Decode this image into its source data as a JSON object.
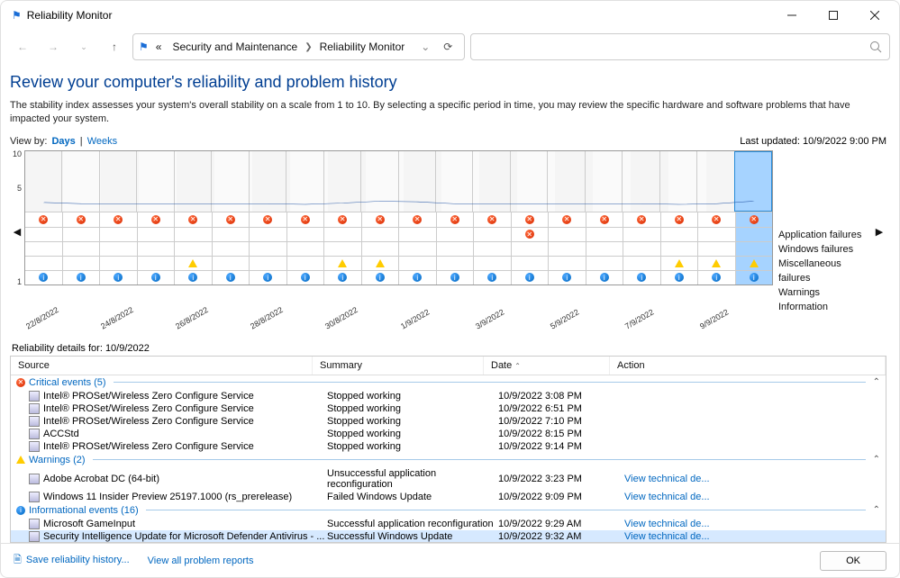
{
  "window": {
    "title": "Reliability Monitor"
  },
  "breadcrumb": {
    "prefix": "«",
    "items": [
      "Security and Maintenance",
      "Reliability Monitor"
    ]
  },
  "heading": "Review your computer's reliability and problem history",
  "description": "The stability index assesses your system's overall stability on a scale from 1 to 10. By selecting a specific period in time, you may review the specific hardware and software problems that have impacted your system.",
  "view": {
    "label": "View by:",
    "option_days": "Days",
    "option_weeks": "Weeks",
    "last_updated_label": "Last updated:",
    "last_updated_value": "10/9/2022 9:00 PM"
  },
  "chart_data": {
    "type": "line",
    "y_ticks": [
      "10",
      "5",
      "1"
    ],
    "row_labels": [
      "Application failures",
      "Windows failures",
      "Miscellaneous failures",
      "Warnings",
      "Information"
    ],
    "columns": [
      {
        "date": "22/8/2022",
        "index": 2.2,
        "app": true,
        "win": false,
        "misc": false,
        "warn": false,
        "info": true,
        "show_date": true
      },
      {
        "date": "23/8/2022",
        "index": 2.0,
        "app": true,
        "win": false,
        "misc": false,
        "warn": false,
        "info": true,
        "show_date": false
      },
      {
        "date": "24/8/2022",
        "index": 2.0,
        "app": true,
        "win": false,
        "misc": false,
        "warn": false,
        "info": true,
        "show_date": true
      },
      {
        "date": "25/8/2022",
        "index": 2.0,
        "app": true,
        "win": false,
        "misc": false,
        "warn": false,
        "info": true,
        "show_date": false
      },
      {
        "date": "26/8/2022",
        "index": 2.0,
        "app": true,
        "win": false,
        "misc": false,
        "warn": true,
        "info": true,
        "show_date": true
      },
      {
        "date": "27/8/2022",
        "index": 2.0,
        "app": true,
        "win": false,
        "misc": false,
        "warn": false,
        "info": true,
        "show_date": false
      },
      {
        "date": "28/8/2022",
        "index": 2.0,
        "app": true,
        "win": false,
        "misc": false,
        "warn": false,
        "info": true,
        "show_date": true
      },
      {
        "date": "29/8/2022",
        "index": 1.9,
        "app": true,
        "win": false,
        "misc": false,
        "warn": false,
        "info": true,
        "show_date": false
      },
      {
        "date": "30/8/2022",
        "index": 2.1,
        "app": true,
        "win": false,
        "misc": false,
        "warn": true,
        "info": true,
        "show_date": true
      },
      {
        "date": "31/8/2022",
        "index": 2.4,
        "app": true,
        "win": false,
        "misc": false,
        "warn": true,
        "info": true,
        "show_date": false
      },
      {
        "date": "1/9/2022",
        "index": 2.3,
        "app": true,
        "win": false,
        "misc": false,
        "warn": false,
        "info": true,
        "show_date": true
      },
      {
        "date": "2/9/2022",
        "index": 2.0,
        "app": true,
        "win": false,
        "misc": false,
        "warn": false,
        "info": true,
        "show_date": false
      },
      {
        "date": "3/9/2022",
        "index": 2.0,
        "app": true,
        "win": false,
        "misc": false,
        "warn": false,
        "info": true,
        "show_date": true
      },
      {
        "date": "4/9/2022",
        "index": 2.0,
        "app": true,
        "win": true,
        "misc": false,
        "warn": false,
        "info": true,
        "show_date": false
      },
      {
        "date": "5/9/2022",
        "index": 2.0,
        "app": true,
        "win": false,
        "misc": false,
        "warn": false,
        "info": true,
        "show_date": true
      },
      {
        "date": "6/9/2022",
        "index": 2.0,
        "app": true,
        "win": false,
        "misc": false,
        "warn": false,
        "info": true,
        "show_date": false
      },
      {
        "date": "7/9/2022",
        "index": 2.0,
        "app": true,
        "win": false,
        "misc": false,
        "warn": false,
        "info": true,
        "show_date": true
      },
      {
        "date": "8/9/2022",
        "index": 1.9,
        "app": true,
        "win": false,
        "misc": false,
        "warn": true,
        "info": true,
        "show_date": false
      },
      {
        "date": "9/9/2022",
        "index": 2.0,
        "app": true,
        "win": false,
        "misc": false,
        "warn": true,
        "info": true,
        "show_date": true
      },
      {
        "date": "10/9/2022",
        "index": 2.4,
        "app": true,
        "win": false,
        "misc": false,
        "warn": true,
        "info": true,
        "show_date": false,
        "selected": true
      }
    ]
  },
  "details": {
    "label_prefix": "Reliability details for:",
    "label_date": "10/9/2022",
    "columns": {
      "source": "Source",
      "summary": "Summary",
      "date": "Date",
      "action": "Action"
    },
    "groups": [
      {
        "title": "Critical events (5)",
        "icon": "err",
        "rows": [
          {
            "source": "Intel® PROSet/Wireless Zero Configure Service",
            "summary": "Stopped working",
            "date": "10/9/2022 3:08 PM",
            "action": ""
          },
          {
            "source": "Intel® PROSet/Wireless Zero Configure Service",
            "summary": "Stopped working",
            "date": "10/9/2022 6:51 PM",
            "action": ""
          },
          {
            "source": "Intel® PROSet/Wireless Zero Configure Service",
            "summary": "Stopped working",
            "date": "10/9/2022 7:10 PM",
            "action": ""
          },
          {
            "source": "ACCStd",
            "summary": "Stopped working",
            "date": "10/9/2022 8:15 PM",
            "action": ""
          },
          {
            "source": "Intel® PROSet/Wireless Zero Configure Service",
            "summary": "Stopped working",
            "date": "10/9/2022 9:14 PM",
            "action": ""
          }
        ]
      },
      {
        "title": "Warnings (2)",
        "icon": "warn",
        "rows": [
          {
            "source": "Adobe Acrobat DC (64-bit)",
            "summary": "Unsuccessful application reconfiguration",
            "date": "10/9/2022 3:23 PM",
            "action": "View technical de..."
          },
          {
            "source": "Windows 11 Insider Preview 25197.1000 (rs_prerelease)",
            "summary": "Failed Windows Update",
            "date": "10/9/2022 9:09 PM",
            "action": "View technical de..."
          }
        ]
      },
      {
        "title": "Informational events (16)",
        "icon": "info",
        "rows": [
          {
            "source": "Microsoft GameInput",
            "summary": "Successful application reconfiguration",
            "date": "10/9/2022 9:29 AM",
            "action": "View technical de..."
          },
          {
            "source": "Security Intelligence Update for Microsoft Defender Antivirus - ...",
            "summary": "Successful Windows Update",
            "date": "10/9/2022 9:32 AM",
            "action": "View technical de...",
            "selected": true
          }
        ]
      }
    ]
  },
  "footer": {
    "save": "Save reliability history...",
    "view_all": "View all problem reports",
    "ok": "OK"
  }
}
